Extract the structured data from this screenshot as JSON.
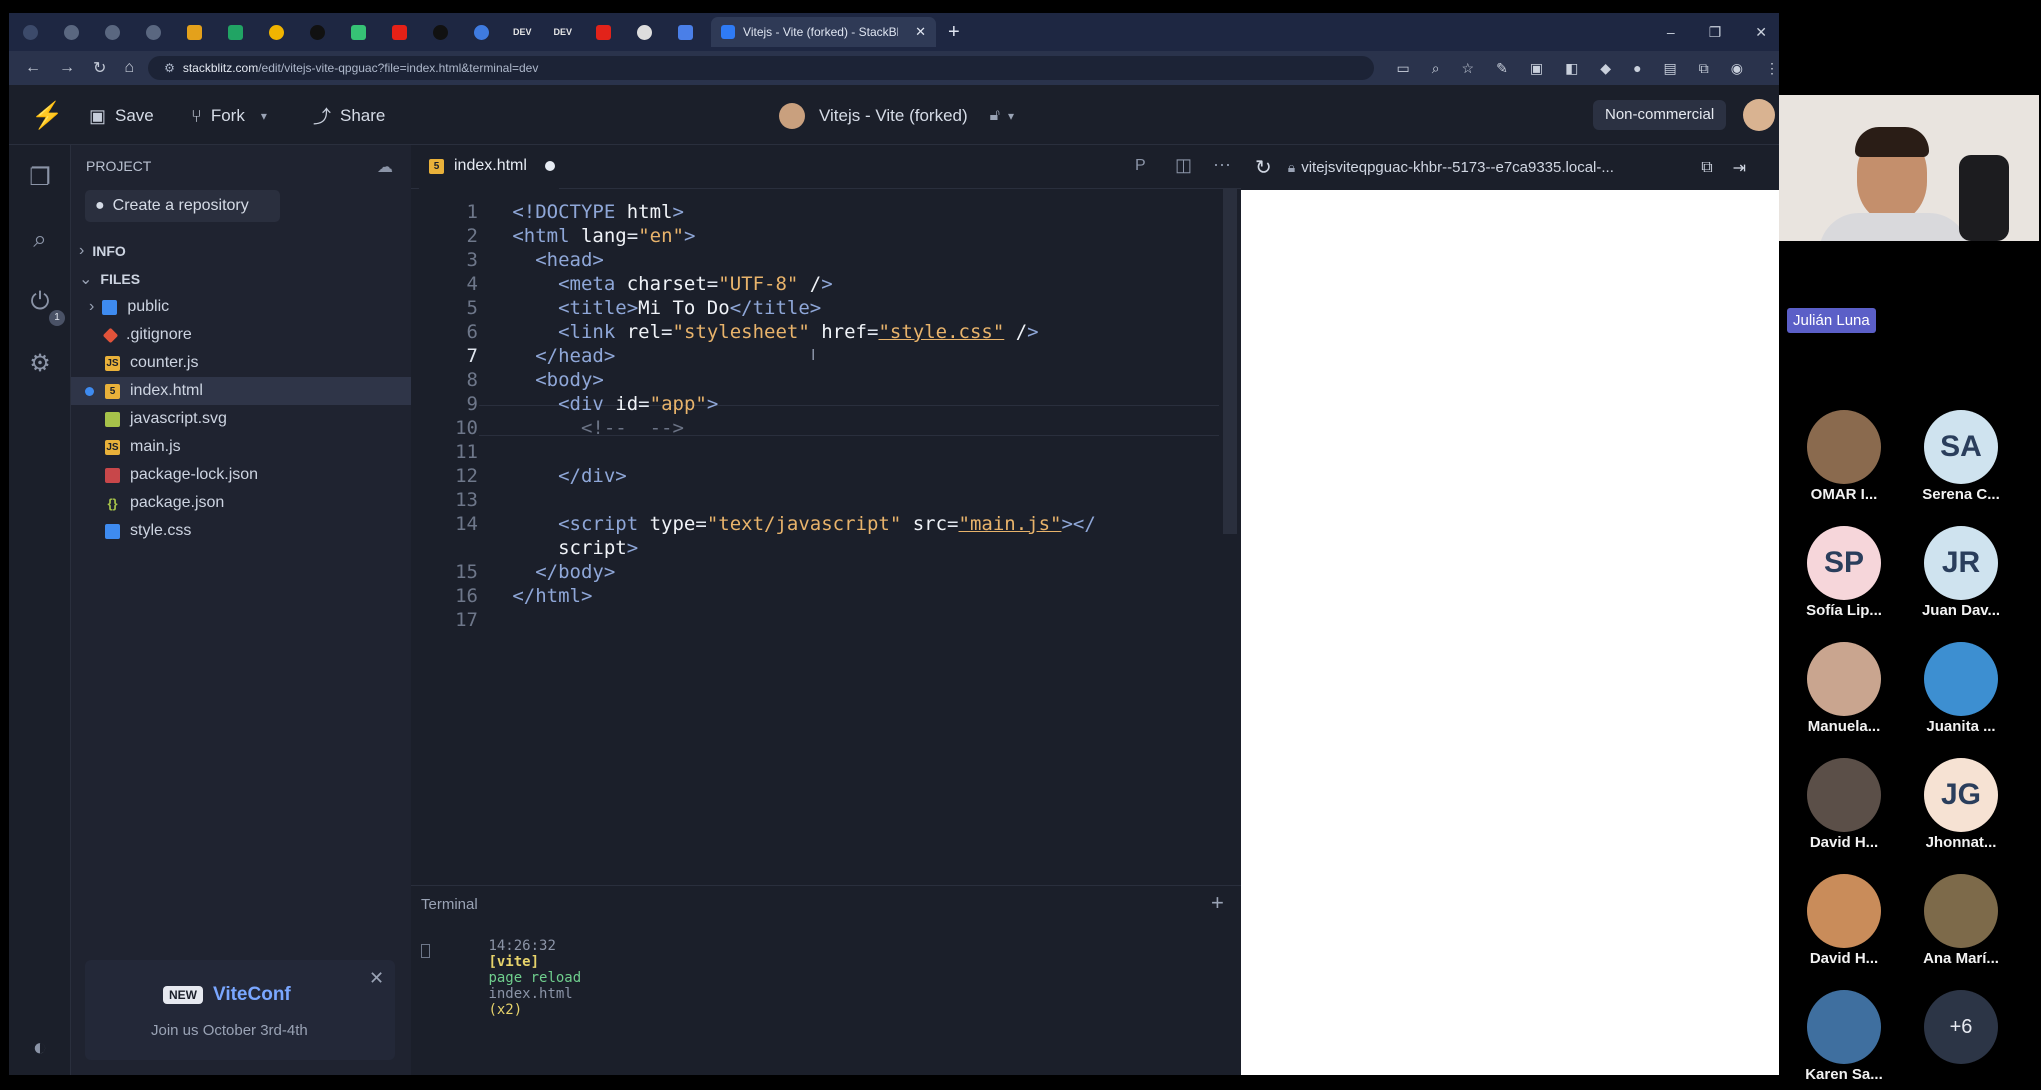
{
  "browser": {
    "active_tab_title": "Vitejs - Vite (forked) - StackBlitz",
    "new_tab": "+",
    "url_domain": "stackblitz.com",
    "url_path": "/edit/vitejs-vite-qpguac?file=index.html&terminal=dev",
    "pinned_tab_labels": [
      "DEV",
      "DEV"
    ]
  },
  "toolbar": {
    "save_label": "Save",
    "fork_label": "Fork",
    "share_label": "Share",
    "project_title": "Vitejs - Vite (forked)",
    "license_badge": "Non-commercial"
  },
  "sidebar": {
    "header": "PROJECT",
    "create_repo": "Create a repository",
    "info_section": "INFO",
    "files_section": "FILES",
    "files": [
      {
        "name": "public",
        "kind": "folder"
      },
      {
        "name": ".gitignore",
        "kind": "git"
      },
      {
        "name": "counter.js",
        "kind": "js"
      },
      {
        "name": "index.html",
        "kind": "html"
      },
      {
        "name": "javascript.svg",
        "kind": "svg"
      },
      {
        "name": "main.js",
        "kind": "js"
      },
      {
        "name": "package-lock.json",
        "kind": "lock"
      },
      {
        "name": "package.json",
        "kind": "json"
      },
      {
        "name": "style.css",
        "kind": "css"
      }
    ],
    "promo": {
      "badge": "NEW",
      "title": "ViteConf",
      "subtitle": "Join us October 3rd-4th"
    },
    "ports_badge": "1"
  },
  "editor": {
    "tab_label": "index.html",
    "preview_url": "vitejsviteqpguac-khbr--5173--e7ca9335.local-...",
    "line_numbers": [
      "1",
      "2",
      "3",
      "4",
      "5",
      "6",
      "7",
      "8",
      "9",
      "10",
      "11",
      "12",
      "13",
      "14",
      "",
      "15",
      "16",
      "17"
    ],
    "lines": [
      {
        "indent": "",
        "text": "<!DOCTYPE html>"
      },
      {
        "indent": "",
        "text": "<html lang=\"en\">"
      },
      {
        "indent": "  ",
        "text": "<head>"
      },
      {
        "indent": "    ",
        "text": "<meta charset=\"UTF-8\" />"
      },
      {
        "indent": "    ",
        "text": "<title>Mi To Do</title>"
      },
      {
        "indent": "    ",
        "text": "<link rel=\"stylesheet\" href=\"style.css\" />"
      },
      {
        "indent": "  ",
        "text": "</head>"
      },
      {
        "indent": "  ",
        "text": "<body>"
      },
      {
        "indent": "    ",
        "text": "<div id=\"app\">"
      },
      {
        "indent": "      ",
        "text": "<!--  -->"
      },
      {
        "indent": "",
        "text": ""
      },
      {
        "indent": "    ",
        "text": "</div>"
      },
      {
        "indent": "",
        "text": ""
      },
      {
        "indent": "    ",
        "text": "<script type=\"text/javascript\" src=\"main.js\"></"
      },
      {
        "indent": "    ",
        "text": "script>"
      },
      {
        "indent": "  ",
        "text": "</body>"
      },
      {
        "indent": "",
        "text": "</html>"
      },
      {
        "indent": "",
        "text": ""
      }
    ]
  },
  "terminal": {
    "title": "Terminal",
    "time": "14:26:32",
    "tag": "[vite]",
    "message": "page reload",
    "file": "index.html",
    "count": "(x2)"
  },
  "meeting": {
    "speaker_name": "Julián Luna",
    "participants": [
      {
        "name": "OMAR I...",
        "initials": "",
        "color": "#8a6a4e"
      },
      {
        "name": "Serena C...",
        "initials": "SA",
        "color": "#cfe3ef"
      },
      {
        "name": "Sofía Lip...",
        "initials": "SP",
        "color": "#f6d6da"
      },
      {
        "name": "Juan Dav...",
        "initials": "JR",
        "color": "#cfe3ef"
      },
      {
        "name": "Manuela...",
        "initials": "",
        "color": "#c9a58f"
      },
      {
        "name": "Juanita ...",
        "initials": "",
        "color": "#3d8fd1"
      },
      {
        "name": "David H...",
        "initials": "",
        "color": "#5b4f48"
      },
      {
        "name": "Jhonnat...",
        "initials": "JG",
        "color": "#f6e2d3"
      },
      {
        "name": "David H...",
        "initials": "",
        "color": "#c98c5a"
      },
      {
        "name": "Ana Marí...",
        "initials": "",
        "color": "#7d6a4a"
      },
      {
        "name": "Karen Sa...",
        "initials": "",
        "color": "#3f6f9f"
      },
      {
        "name": "",
        "initials": "+6",
        "color": "#2c3546"
      }
    ]
  }
}
